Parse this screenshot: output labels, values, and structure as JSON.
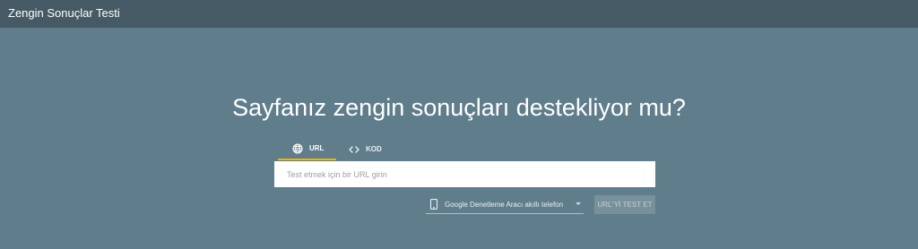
{
  "app": {
    "title": "Zengin Sonuçlar Testi"
  },
  "main": {
    "headline": "Sayfanız zengin sonuçları destekliyor mu?",
    "tabs": [
      {
        "label": "URL",
        "icon": "globe-icon",
        "active": true
      },
      {
        "label": "KOD",
        "icon": "code-icon",
        "active": false
      }
    ],
    "url_input": {
      "placeholder": "Test etmek için bir URL girin",
      "value": ""
    },
    "device_select": {
      "icon": "smartphone-icon",
      "selected": "Google Denetleme Aracı akıllı telefon"
    },
    "test_button": {
      "label": "URL'Yİ TEST ET"
    }
  },
  "colors": {
    "background": "#607d8b",
    "topbar": "#455a64",
    "active_tab_underline": "#f4b400",
    "input_background": "#ffffff"
  }
}
